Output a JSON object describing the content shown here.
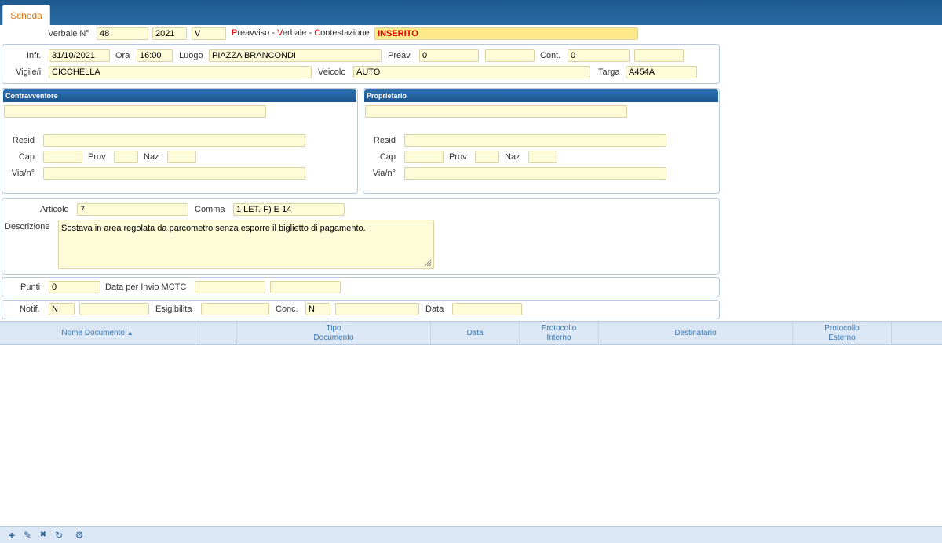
{
  "tab": {
    "label": "Scheda"
  },
  "header": {
    "verbale_label": "Verbale N°",
    "verbale_numero": "48",
    "verbale_anno": "2021",
    "verbale_tipo": "V",
    "status_p": "P",
    "status_p_rest": "reavviso - ",
    "status_v": "V",
    "status_v_rest": "erbale - ",
    "status_c": "C",
    "status_c_rest": "ontestazione",
    "status_value": "INSERITO"
  },
  "infrazione": {
    "infr_label": "Infr.",
    "infr_value": "31/10/2021",
    "ora_label": "Ora",
    "ora_value": "16:00",
    "luogo_label": "Luogo",
    "luogo_value": "PIAZZA BRANCONDI",
    "preav_label": "Preav.",
    "preav_value": "0",
    "preav_extra": "",
    "cont_label": "Cont.",
    "cont_value": "0",
    "cont_extra": "",
    "vigile_label": "Vigile/i",
    "vigile_value": "CICCHELLA",
    "veicolo_label": "Veicolo",
    "veicolo_value": "AUTO",
    "targa_label": "Targa",
    "targa_value": "A454A"
  },
  "contravventore": {
    "title": "Contravventore",
    "nome": "",
    "resid_label": "Resid",
    "resid": "",
    "cap_label": "Cap",
    "cap": "",
    "prov_label": "Prov",
    "prov": "",
    "naz_label": "Naz",
    "naz": "",
    "via_label": "Via/n°",
    "via": ""
  },
  "proprietario": {
    "title": "Proprietario",
    "nome": "",
    "resid_label": "Resid",
    "resid": "",
    "cap_label": "Cap",
    "cap": "",
    "prov_label": "Prov",
    "prov": "",
    "naz_label": "Naz",
    "naz": "",
    "via_label": "Via/n°",
    "via": ""
  },
  "articolo": {
    "articolo_label": "Articolo",
    "articolo_value": "7",
    "comma_label": "Comma",
    "comma_value": "1 LET. F) E 14",
    "descrizione_label": "Descrizione",
    "descrizione_value": "Sostava in area regolata da parcometro senza esporre il biglietto di pagamento."
  },
  "punti": {
    "punti_label": "Punti",
    "punti_value": "0",
    "mctc_label": "Data per Invio MCTC",
    "mctc_value1": "",
    "mctc_value2": ""
  },
  "notifica": {
    "notif_label": "Notif.",
    "notif_value": "N",
    "notif_extra": "",
    "esig_label": "Esigibilita",
    "esig_value": "",
    "conc_label": "Conc.",
    "conc_value": "N",
    "conc_extra": "",
    "data_label": "Data",
    "data_value": ""
  },
  "grid": {
    "columns": [
      {
        "line1": "Nome Documento",
        "line2": ""
      },
      {
        "line1": "",
        "line2": ""
      },
      {
        "line1": "Tipo",
        "line2": "Documento"
      },
      {
        "line1": "Data",
        "line2": ""
      },
      {
        "line1": "Protocollo",
        "line2": "Interno"
      },
      {
        "line1": "Destinatario",
        "line2": ""
      },
      {
        "line1": "Protocollo",
        "line2": "Esterno"
      }
    ],
    "sort_indicator": "▲"
  },
  "toolbar": {
    "icons": [
      "add-icon",
      "edit-icon",
      "delete-icon",
      "refresh-icon",
      "settings-icon"
    ],
    "glyphs": [
      "+",
      "✎",
      "✖",
      "↻",
      "⚙"
    ]
  },
  "colors": {
    "header_bar": "#1e5a8e",
    "tab_text": "#e07b17",
    "field_bg": "#fefbd9",
    "status_red": "#e00000",
    "grid_header_bg": "#dce7f6"
  }
}
